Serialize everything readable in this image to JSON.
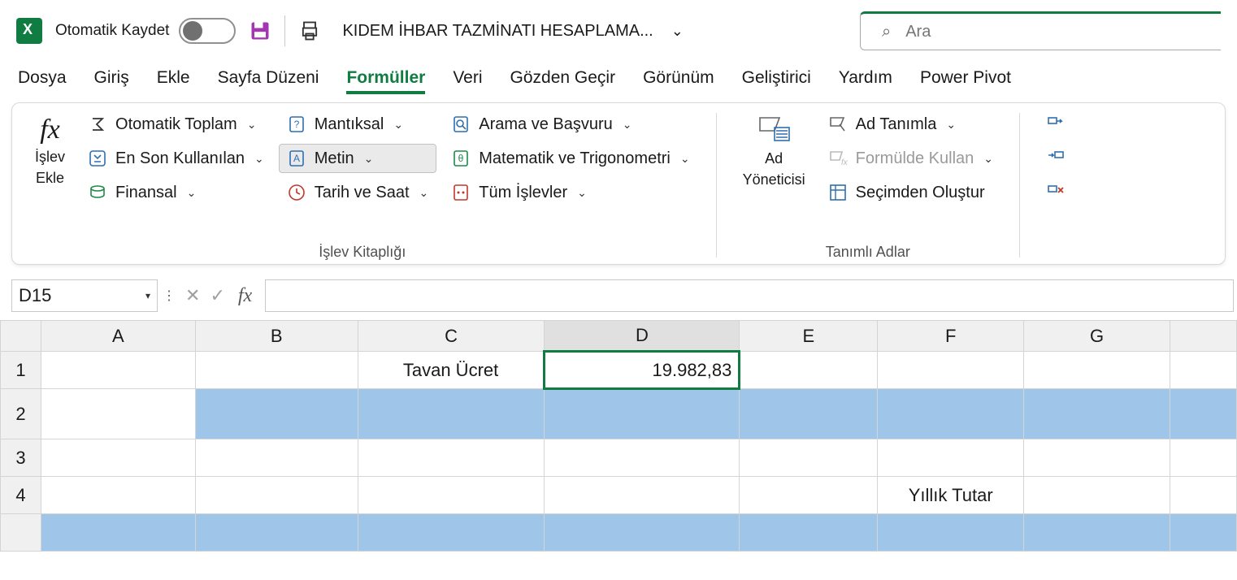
{
  "titlebar": {
    "autosave_label": "Otomatik Kaydet",
    "filename": "KIDEM İHBAR TAZMİNATI HESAPLAMA...",
    "search_placeholder": "Ara"
  },
  "tabs": {
    "dosya": "Dosya",
    "giris": "Giriş",
    "ekle": "Ekle",
    "sayfa_duzeni": "Sayfa Düzeni",
    "formuller": "Formüller",
    "veri": "Veri",
    "gozden_gecir": "Gözden Geçir",
    "gorunum": "Görünüm",
    "gelistirici": "Geliştirici",
    "yardim": "Yardım",
    "power_pivot": "Power Pivot"
  },
  "ribbon": {
    "islev_ekle_1": "İşlev",
    "islev_ekle_2": "Ekle",
    "oto_toplam": "Otomatik Toplam",
    "en_son": "En Son Kullanılan",
    "finansal": "Finansal",
    "mantiksal": "Mantıksal",
    "metin": "Metin",
    "tarih_saat": "Tarih ve Saat",
    "arama": "Arama ve Başvuru",
    "matematik": "Matematik ve Trigonometri",
    "tum_islevler": "Tüm İşlevler",
    "group_label_1": "İşlev Kitaplığı",
    "ad_yoneticisi_1": "Ad",
    "ad_yoneticisi_2": "Yöneticisi",
    "ad_tanimla": "Ad Tanımla",
    "formülde_kullan": "Formülde Kullan",
    "secimden_olustur": "Seçimden Oluştur",
    "group_label_2": "Tanımlı Adlar"
  },
  "formula_bar": {
    "cell_ref": "D15",
    "formula_value": ""
  },
  "columns": {
    "A": "A",
    "B": "B",
    "C": "C",
    "D": "D",
    "E": "E",
    "F": "F",
    "G": "G"
  },
  "rows": {
    "1": "1",
    "2": "2",
    "3": "3",
    "4": "4"
  },
  "cells": {
    "C1": "Tavan Ücret",
    "D1": "19.982,83",
    "F4": "Yıllık Tutar"
  }
}
